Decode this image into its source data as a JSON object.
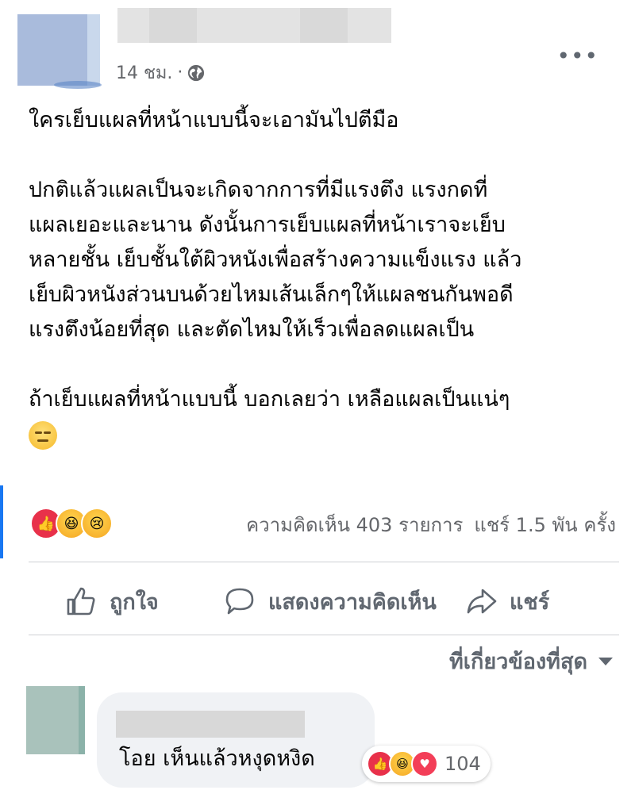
{
  "post": {
    "time": "14 ชม.",
    "separator": "·",
    "paragraphs": [
      [
        "ใครเย็บแผลที่หน้าแบบนี้จะเอามันไปตีมือ"
      ],
      [
        "ปกติแล้วแผลเป็นจะเกิดจากการที่มีแรงตึง แรงกดที่",
        "แผลเยอะและนาน ดังนั้นการเย็บแผลที่หน้าเราจะเย็บ",
        "หลายชั้น เย็บชั้นใต้ผิวหนังเพื่อสร้างความแข็งแรง แล้ว",
        "เย็บผิวหนังส่วนบนด้วยไหมเส้นเล็กๆให้แผลชนกันพอดี",
        "แรงตึงน้อยที่สุด และตัดไหมให้เร็วเพื่อลดแผลเป็น"
      ],
      [
        "ถ้าเย็บแผลที่หน้าแบบนี้ บอกเลยว่า เหลือแผลเป็นแน่ๆ"
      ]
    ],
    "emoji": "expressionless-face",
    "reactions": [
      "like",
      "haha",
      "sad"
    ],
    "comments_count": "ความคิดเห็น 403 รายการ",
    "shares_count": "แชร์ 1.5 พัน ครั้ง"
  },
  "actions": {
    "like_label": "ถูกใจ",
    "comment_label": "แสดงความคิดเห็น",
    "share_label": "แชร์"
  },
  "sort": {
    "label": "ที่เกี่ยวข้องที่สุด"
  },
  "comment": {
    "text": "โอย เห็นแล้วหงุดหงิด",
    "reactions": [
      "like",
      "haha",
      "love"
    ],
    "reaction_count": "104"
  },
  "colors": {
    "accent": "#1877f2",
    "meta_text": "#65676b",
    "bubble_bg": "#f0f2f5",
    "like_red": "#e8314a"
  }
}
